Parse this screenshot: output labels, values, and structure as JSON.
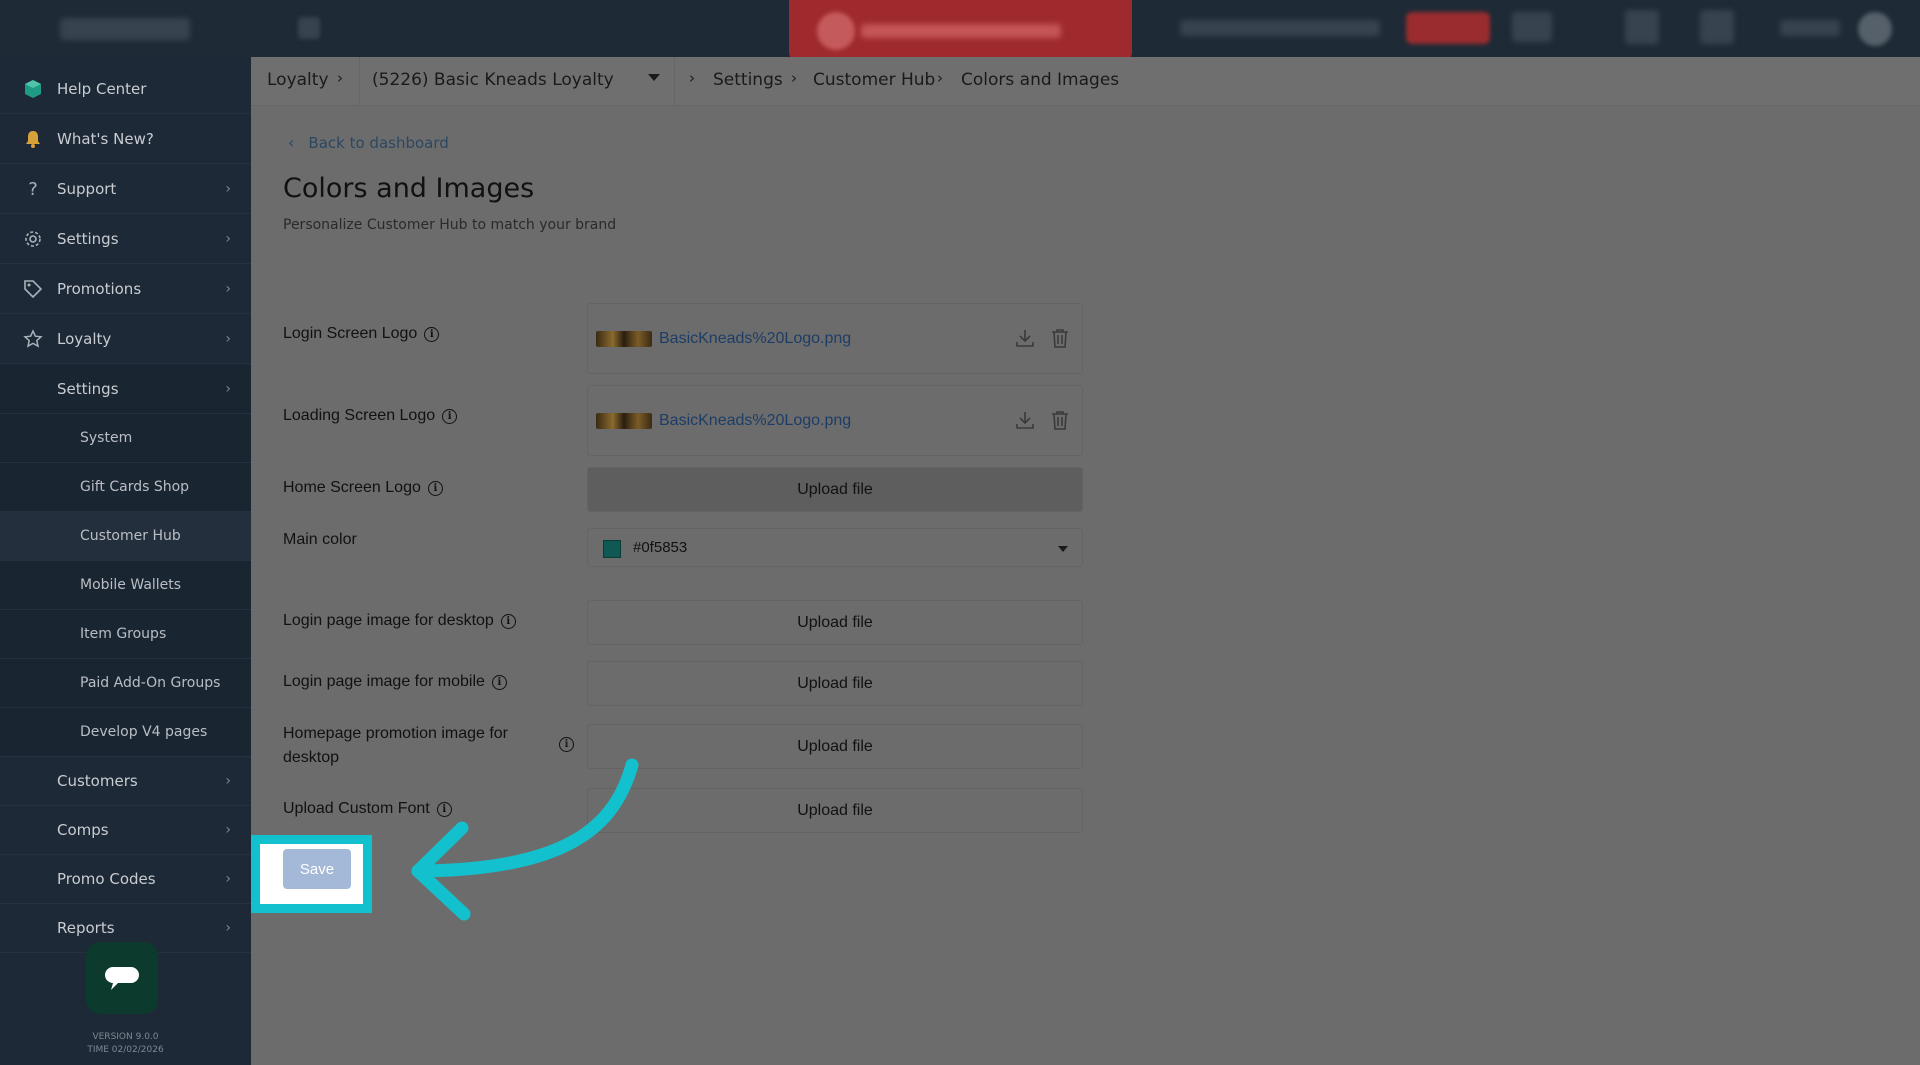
{
  "breadcrumb": {
    "root": "Loyalty",
    "program": "(5226) Basic Kneads Loyalty",
    "settings": "Settings",
    "customer_hub": "Customer Hub",
    "current": "Colors and Images"
  },
  "sidebar": {
    "items": [
      {
        "label": "Help Center",
        "icon": "help-center-icon"
      },
      {
        "label": "What's New?",
        "icon": "bell-icon"
      },
      {
        "label": "Support",
        "icon": "question-icon"
      },
      {
        "label": "Settings",
        "icon": "gear-icon"
      },
      {
        "label": "Promotions",
        "icon": "tag-icon"
      },
      {
        "label": "Loyalty",
        "icon": "star-icon"
      }
    ],
    "loyalty_sub": {
      "settings": "Settings",
      "children": [
        "System",
        "Gift Cards Shop",
        "Customer Hub",
        "Mobile Wallets",
        "Item Groups",
        "Paid Add-On Groups",
        "Develop V4 pages"
      ]
    },
    "more": [
      "Customers",
      "Comps",
      "Promo Codes",
      "Reports"
    ],
    "version": "VERSION 9.0.0",
    "time": "TIME 02/02/2026"
  },
  "page": {
    "back_label": "Back to dashboard",
    "title": "Colors and Images",
    "subtitle": "Personalize Customer Hub to match your brand"
  },
  "form": {
    "login_logo_label": "Login Screen Logo",
    "login_logo_file": "BasicKneads%20Logo.png",
    "loading_logo_label": "Loading Screen Logo",
    "loading_logo_file": "BasicKneads%20Logo.png",
    "home_logo_label": "Home Screen Logo",
    "main_color_label": "Main color",
    "main_color_value": "#0f5853",
    "main_color_display": "#0f5853",
    "login_desktop_label": "Login page image for desktop",
    "login_mobile_label": "Login page image for mobile",
    "promo_desktop_label_1": "Homepage promotion image for",
    "promo_desktop_label_2": "desktop",
    "custom_font_label": "Upload Custom Font",
    "upload_label": "Upload file",
    "save_label": "Save"
  },
  "colors": {
    "sidebar": "#1d2937",
    "overlay": "#6c6c6c",
    "highlight": "#12c1cd",
    "save_button": "#a4b8d8",
    "alert": "#9f2a2d"
  }
}
